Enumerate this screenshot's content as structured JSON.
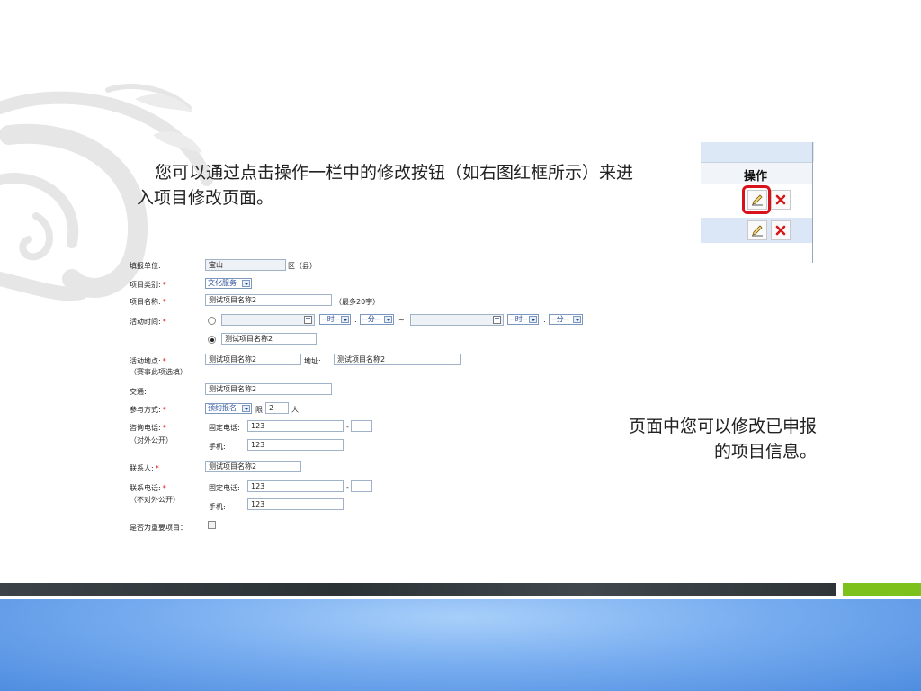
{
  "slide": {
    "intro_text": "您可以通过点击操作一栏中的修改按钮（如右图红框所示）来进入项目修改页面。",
    "side_note": "页面中您可以修改已申报的项目信息。"
  },
  "operations_table": {
    "header": "操作",
    "rows": [
      {
        "edit_icon": "pencil-edit-icon",
        "delete_icon": "red-x-delete-icon",
        "highlighted": true
      },
      {
        "edit_icon": "pencil-edit-icon",
        "delete_icon": "red-x-delete-icon",
        "highlighted": false
      }
    ]
  },
  "form": {
    "unit": {
      "label": "填报单位:",
      "value": "宝山",
      "suffix": "区（县）"
    },
    "category": {
      "label": "项目类别:",
      "value": "文化服务"
    },
    "name": {
      "label": "项目名称:",
      "value": "测试项目名称2",
      "hint": "（最多20字）"
    },
    "time": {
      "label": "活动时间:",
      "hour_placeholder": "--时--",
      "minute_placeholder": "--分--",
      "colon": ":",
      "tilde": "~",
      "alt_value": "测试项目名称2"
    },
    "location": {
      "label": "活动地点:",
      "note": "（赛事此项选填）",
      "value": "测试项目名称2",
      "address_label": "地址:",
      "address_value": "测试项目名称2"
    },
    "traffic": {
      "label": "交通:",
      "value": "测试项目名称2"
    },
    "join": {
      "label": "参与方式:",
      "value": "预约报名",
      "limit_label": "限",
      "limit_value": "2",
      "unit": "人"
    },
    "consult": {
      "label": "咨询电话:",
      "note": "（对外公开）",
      "fixed_label": "固定电话:",
      "fixed_value": "123",
      "dash": "-",
      "mobile_label": "手机:",
      "mobile_value": "123"
    },
    "contact": {
      "label": "联系人:",
      "value": "测试项目名称2"
    },
    "contact_phone": {
      "label": "联系电话:",
      "note": "（不对外公开）",
      "fixed_label": "固定电话:",
      "fixed_value": "123",
      "dash": "-",
      "mobile_label": "手机:",
      "mobile_value": "123"
    },
    "important": {
      "label": "是否为重要项目："
    },
    "required_mark": "*"
  },
  "colors": {
    "accent_green": "#7dc21c",
    "highlight_red": "#d8121d",
    "link_blue": "#2a4f9a"
  }
}
